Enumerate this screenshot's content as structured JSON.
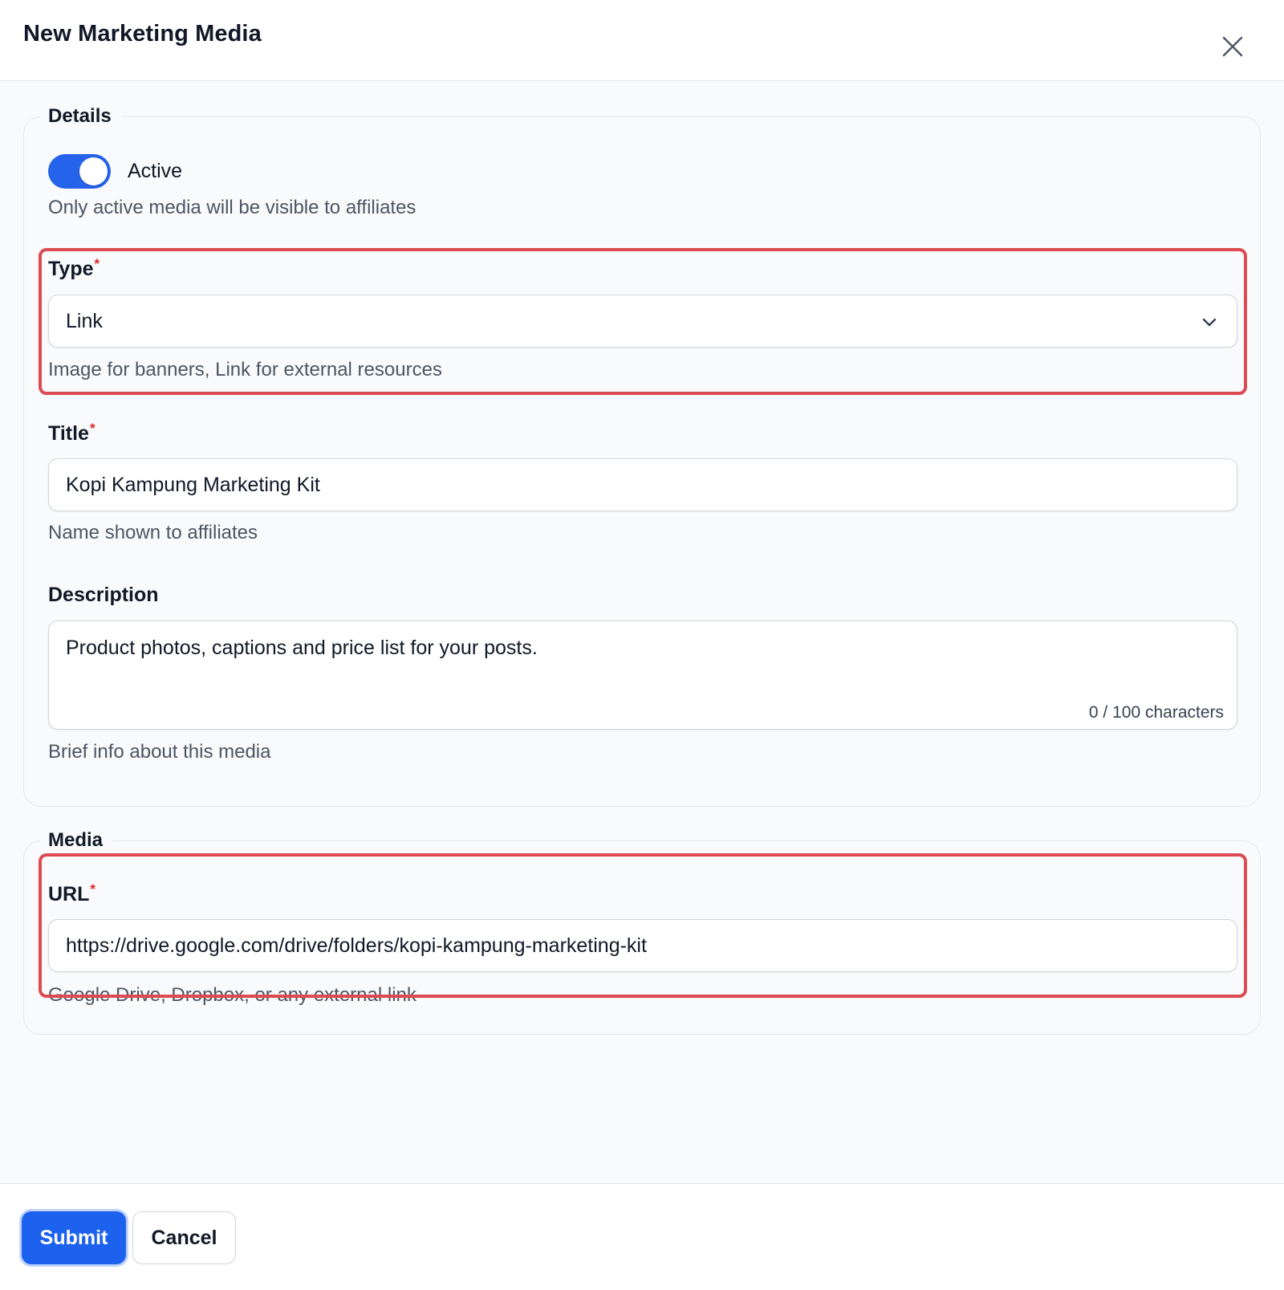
{
  "dialog": {
    "title": "New Marketing Media",
    "close_icon": "close-icon"
  },
  "details": {
    "legend": "Details",
    "active": {
      "label": "Active",
      "checked": true,
      "hint": "Only active media will be visible to affiliates"
    },
    "type": {
      "label": "Type",
      "required_mark": "*",
      "value": "Link",
      "hint": "Image for banners, Link for external resources"
    },
    "title_field": {
      "label": "Title",
      "required_mark": "*",
      "value": "Kopi Kampung Marketing Kit",
      "hint": "Name shown to affiliates"
    },
    "description": {
      "label": "Description",
      "value": "Product photos, captions and price list for your posts.",
      "counter": "0 / 100 characters",
      "hint": "Brief info about this media"
    }
  },
  "media": {
    "legend": "Media",
    "url": {
      "label": "URL",
      "required_mark": "*",
      "value": "https://drive.google.com/drive/folders/kopi-kampung-marketing-kit",
      "hint": "Google Drive, Dropbox, or any external link"
    }
  },
  "footer": {
    "submit_label": "Submit",
    "cancel_label": "Cancel"
  },
  "colors": {
    "accent": "#1d62ef",
    "toggle_on": "#2563eb",
    "highlight": "#dc4a52",
    "required": "#dc2626"
  }
}
